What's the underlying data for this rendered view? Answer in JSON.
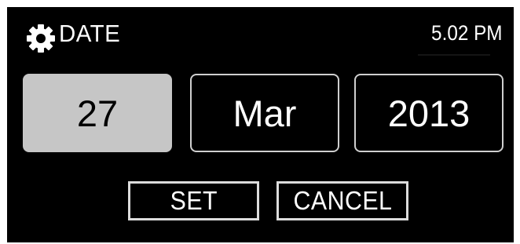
{
  "header": {
    "icon": "gear-icon",
    "title": "DATE",
    "time": "5.02 PM"
  },
  "date_fields": {
    "day": "27",
    "month": "Mar",
    "year": "2013",
    "selected": "day"
  },
  "actions": {
    "set_label": "SET",
    "cancel_label": "CANCEL"
  },
  "colors": {
    "background": "#000000",
    "text": "#ffffff",
    "selected_field": "#c6c6c6",
    "border": "#cfcfcf"
  }
}
